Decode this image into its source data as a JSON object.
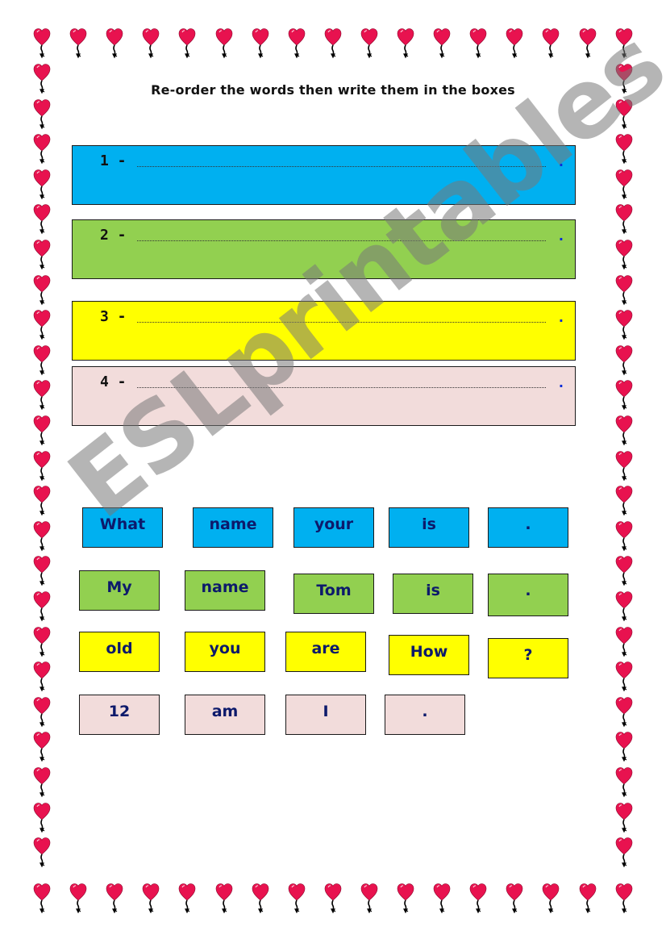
{
  "worksheet": {
    "title": "Re-order the words then write them in the boxes",
    "watermark": "ESLprintables.com",
    "colors": {
      "blue": "#00b0f0",
      "green": "#92d050",
      "yellow": "#ffff00",
      "pink": "#f2dcdb",
      "heart": "#e8124f",
      "tile_text": "#0d1a6b"
    }
  },
  "answer_boxes": [
    {
      "number": "1 -",
      "end_mark": ".",
      "color": "#00b0f0"
    },
    {
      "number": "2 -",
      "end_mark": ".",
      "color": "#92d050"
    },
    {
      "number": "3 -",
      "end_mark": ".",
      "color": "#ffff00"
    },
    {
      "number": "4 -",
      "end_mark": ".",
      "color": "#f2dcdb"
    }
  ],
  "word_rows": [
    {
      "color": "#00b0f0",
      "words": [
        "What",
        "name",
        "your",
        "is",
        "."
      ]
    },
    {
      "color": "#92d050",
      "words": [
        "My",
        "name",
        "Tom",
        "is",
        "."
      ]
    },
    {
      "color": "#ffff00",
      "words": [
        "old",
        "you",
        "are",
        "How",
        "?"
      ]
    },
    {
      "color": "#f2dcdb",
      "words": [
        "12",
        "am",
        "I",
        "."
      ]
    }
  ]
}
